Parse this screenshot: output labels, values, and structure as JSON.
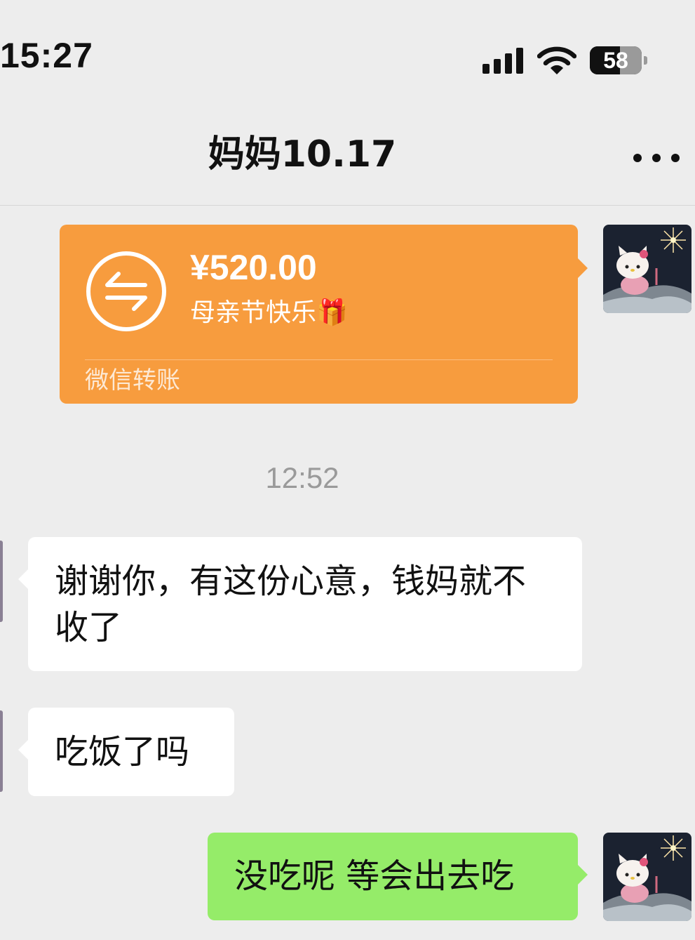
{
  "status_bar": {
    "time": "15:27",
    "battery_level": "58"
  },
  "header": {
    "title": "妈妈10.17",
    "more_icon": "ellipsis-icon"
  },
  "transfer": {
    "amount": "¥520.00",
    "note": "母亲节快乐🎁",
    "label": "微信转账",
    "icon": "transfer-arrows-icon",
    "card_color": "#f79c3e"
  },
  "timestamp": "12:52",
  "messages": [
    {
      "from": "contact",
      "text": "谢谢你，有这份心意，钱妈就不收了"
    },
    {
      "from": "contact",
      "text": "吃饭了吗"
    },
    {
      "from": "me",
      "text": "没吃呢 等会出去吃"
    }
  ],
  "colors": {
    "background": "#ededed",
    "incoming_bubble": "#ffffff",
    "outgoing_bubble": "#95ec69",
    "timestamp": "#9a9a9a"
  }
}
